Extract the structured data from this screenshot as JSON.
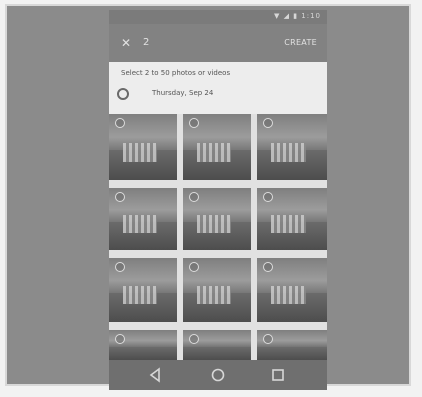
{
  "status_bar": {
    "indicators": "▼ ◢ ▮ 1:10"
  },
  "app_bar": {
    "close_icon": "close-icon",
    "selected_count": "2",
    "create_label": "CREATE"
  },
  "header": {
    "select_text": "Select 2 to 50 photos or videos",
    "date_label": "Thursday, Sep 24"
  },
  "grid": {
    "tiles": [
      {
        "selected": false
      },
      {
        "selected": false
      },
      {
        "selected": false
      },
      {
        "selected": false
      },
      {
        "selected": false
      },
      {
        "selected": false
      },
      {
        "selected": false
      },
      {
        "selected": false
      },
      {
        "selected": false
      },
      {
        "selected": false
      },
      {
        "selected": false
      },
      {
        "selected": false
      }
    ]
  },
  "nav_bar": {
    "icons": [
      "back-icon",
      "home-icon",
      "recent-apps-icon"
    ]
  }
}
